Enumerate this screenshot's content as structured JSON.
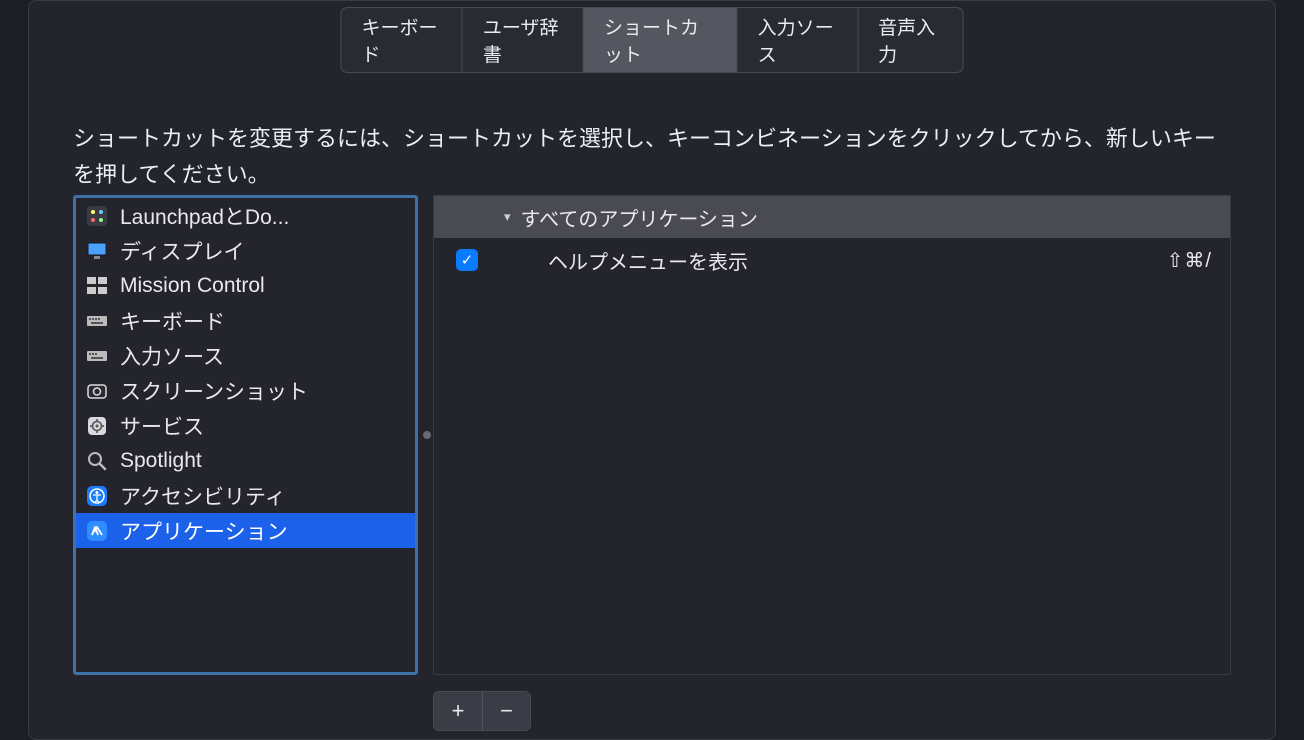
{
  "tabs": {
    "keyboard": "キーボード",
    "user_dict": "ユーザ辞書",
    "shortcuts": "ショートカット",
    "input_sources": "入力ソース",
    "dictation": "音声入力"
  },
  "instruction": "ショートカットを変更するには、ショートカットを選択し、キーコンビネーションをクリックしてから、新しいキーを押してください。",
  "sidebar": {
    "items": [
      {
        "label": "LaunchpadとDo..."
      },
      {
        "label": "ディスプレイ"
      },
      {
        "label": "Mission Control"
      },
      {
        "label": "キーボード"
      },
      {
        "label": "入力ソース"
      },
      {
        "label": "スクリーンショット"
      },
      {
        "label": "サービス"
      },
      {
        "label": "Spotlight"
      },
      {
        "label": "アクセシビリティ"
      },
      {
        "label": "アプリケーション"
      }
    ]
  },
  "detail": {
    "header": "すべてのアプリケーション",
    "rows": [
      {
        "label": "ヘルプメニューを表示",
        "shortcut": "⇧⌘/"
      }
    ]
  },
  "buttons": {
    "plus": "+",
    "minus": "−"
  }
}
